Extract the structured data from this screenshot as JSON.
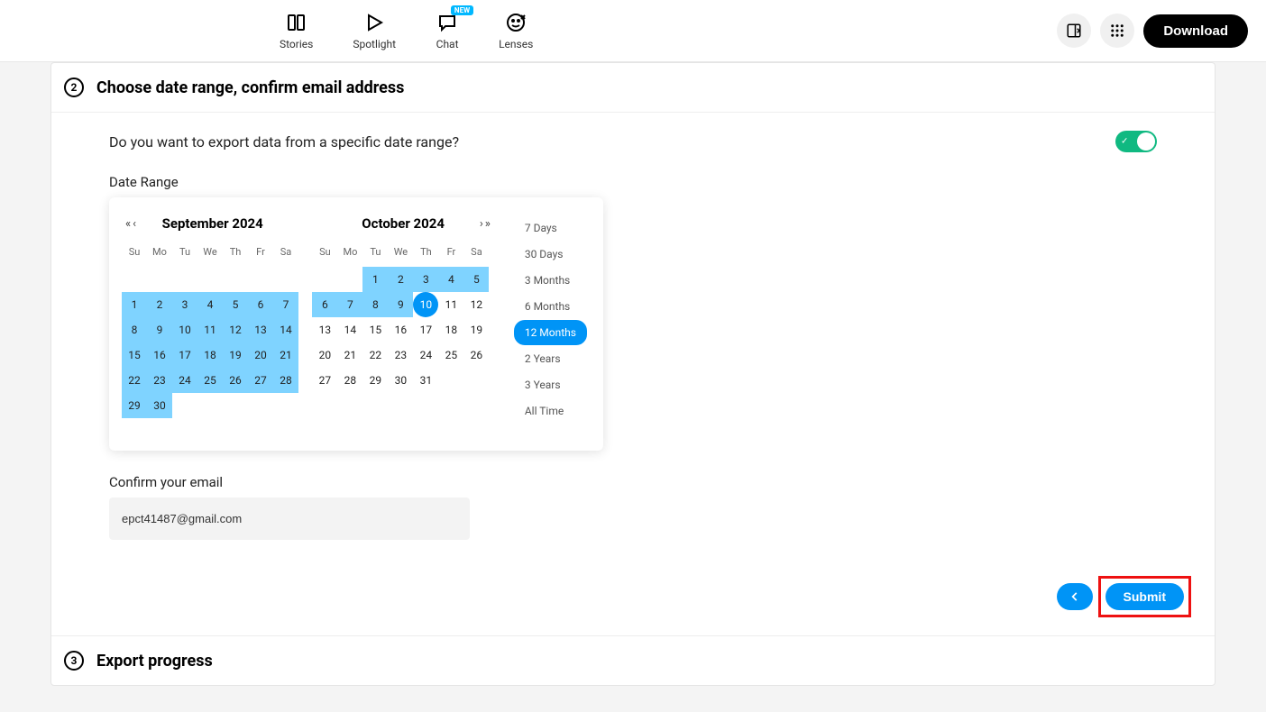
{
  "nav": {
    "stories": "Stories",
    "spotlight": "Spotlight",
    "chat": "Chat",
    "chat_badge": "NEW",
    "lenses": "Lenses"
  },
  "header": {
    "download": "Download"
  },
  "step2": {
    "number": "2",
    "title": "Choose date range, confirm email address",
    "question": "Do you want to export data from a specific date range?",
    "range_label": "Date Range"
  },
  "calendar": {
    "dow": [
      "Su",
      "Mo",
      "Tu",
      "We",
      "Th",
      "Fr",
      "Sa"
    ],
    "left": {
      "title": "September 2024",
      "days": [
        "",
        "",
        "",
        "",
        "",
        "",
        "",
        "1",
        "2",
        "3",
        "4",
        "5",
        "6",
        "7",
        "8",
        "9",
        "10",
        "11",
        "12",
        "13",
        "14",
        "15",
        "16",
        "17",
        "18",
        "19",
        "20",
        "21",
        "22",
        "23",
        "24",
        "25",
        "26",
        "27",
        "28",
        "29",
        "30",
        "",
        "",
        "",
        "",
        ""
      ],
      "in_range_start": 7,
      "in_range_end": 37
    },
    "right": {
      "title": "October 2024",
      "days": [
        "",
        "",
        "1",
        "2",
        "3",
        "4",
        "5",
        "6",
        "7",
        "8",
        "9",
        "10",
        "11",
        "12",
        "13",
        "14",
        "15",
        "16",
        "17",
        "18",
        "19",
        "20",
        "21",
        "22",
        "23",
        "24",
        "25",
        "26",
        "27",
        "28",
        "29",
        "30",
        "31",
        "",
        ""
      ],
      "in_range_start": 2,
      "in_range_end": 10,
      "end_index": 11
    }
  },
  "presets": [
    {
      "label": "7 Days",
      "active": false
    },
    {
      "label": "30 Days",
      "active": false
    },
    {
      "label": "3 Months",
      "active": false
    },
    {
      "label": "6 Months",
      "active": false
    },
    {
      "label": "12 Months",
      "active": true
    },
    {
      "label": "2 Years",
      "active": false
    },
    {
      "label": "3 Years",
      "active": false
    },
    {
      "label": "All Time",
      "active": false
    }
  ],
  "email": {
    "label": "Confirm your email",
    "value": "epct41487@gmail.com"
  },
  "actions": {
    "submit": "Submit"
  },
  "step3": {
    "number": "3",
    "title": "Export progress"
  }
}
